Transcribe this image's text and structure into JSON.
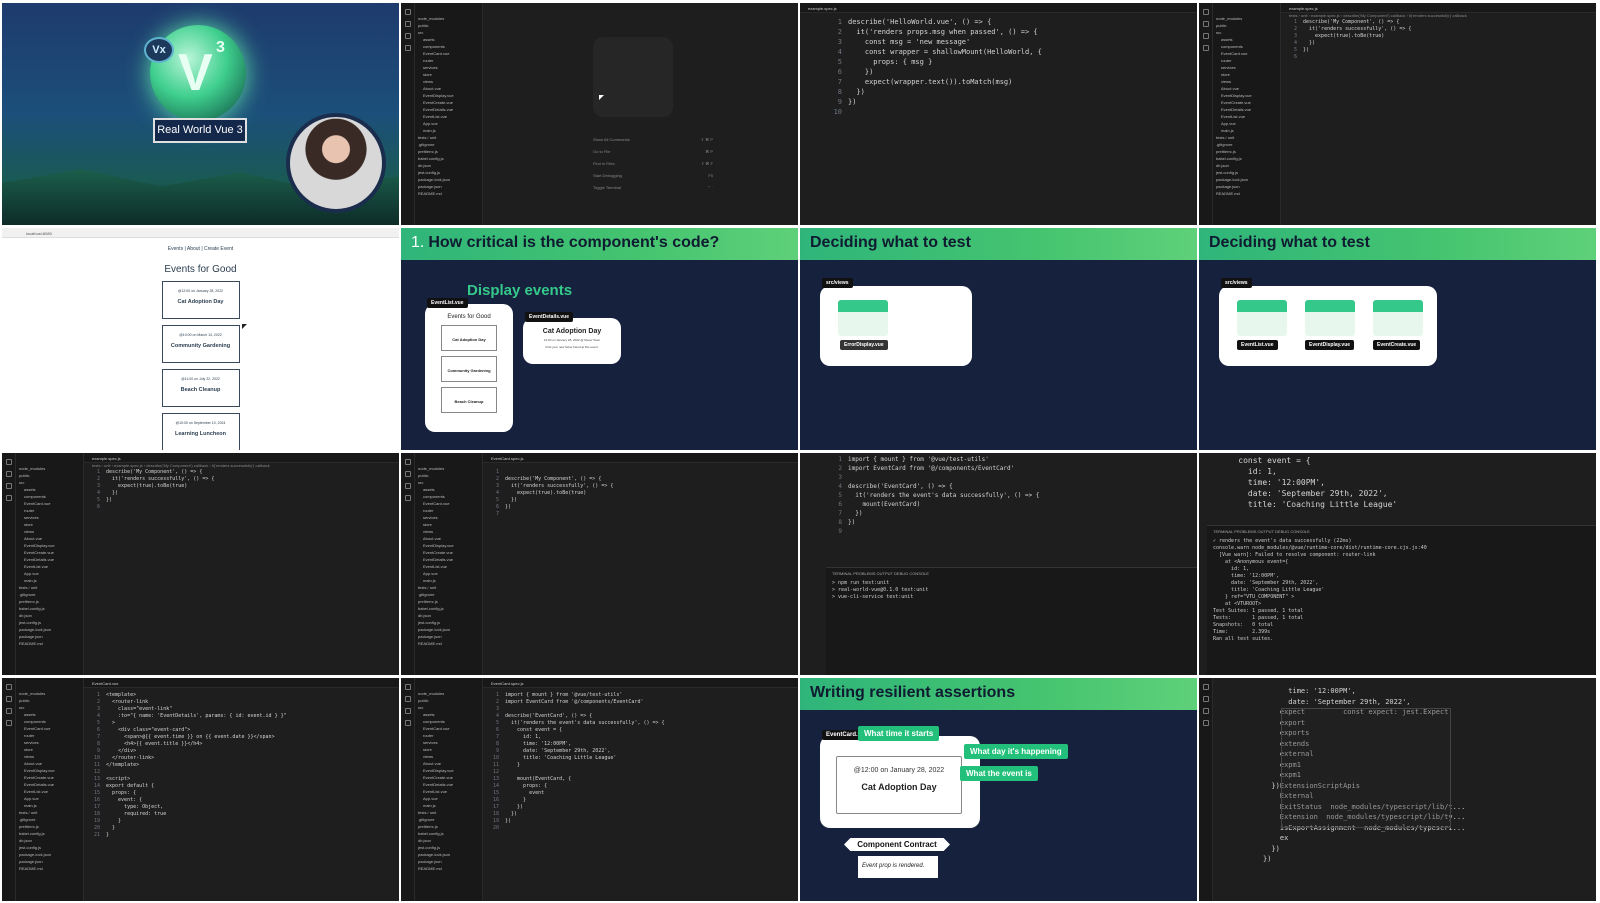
{
  "c1": {
    "logo_badge": "Vx",
    "logo_letter": "V",
    "logo_super": "3",
    "course_title": "Real World Vue 3"
  },
  "c2": {
    "tree": [
      "node_modules",
      "public",
      "src",
      "assets",
      "components",
      "EventCard.vue",
      "router",
      "services",
      "store",
      "views",
      "About.vue",
      "EventDisplay.vue",
      "EventCreate.vue",
      "EventDetails.vue",
      "EventList.vue",
      "App.vue",
      "main.js",
      "tests / unit",
      ".gitignore",
      "prettierrc.js",
      "babel.config.js",
      "db.json",
      "jest.config.js",
      "package-lock.json",
      "package.json",
      "README.md"
    ],
    "shortcuts": [
      {
        "label": "Show All Commands",
        "keys": "⇧ ⌘ P"
      },
      {
        "label": "Go to File",
        "keys": "⌘ P"
      },
      {
        "label": "Find in Files",
        "keys": "⇧ ⌘ F"
      },
      {
        "label": "Start Debugging",
        "keys": "F5"
      },
      {
        "label": "Toggle Terminal",
        "keys": "⌃ `"
      }
    ]
  },
  "c3": {
    "tab": "example.spec.js",
    "lines": [
      "describe('HelloWorld.vue', () => {",
      "  it('renders props.msg when passed', () => {",
      "    const msg = 'new message'",
      "    const wrapper = shallowMount(HelloWorld, {",
      "      props: { msg }",
      "    })",
      "    expect(wrapper.text()).toMatch(msg)",
      "  })",
      "})",
      ""
    ]
  },
  "c4": {
    "tab": "example.spec.js",
    "crumb": "tests › unit › example.spec.js › describe('My Component') callback › it('renders successfully') callback",
    "lines": [
      "describe('My Component', () => {",
      "  it('renders successfully', () => {",
      "    expect(true).toBe(true)",
      "  })",
      "})",
      ""
    ]
  },
  "c5": {
    "url": "localhost:8080",
    "nav": "Events | About | Create Event",
    "heading": "Events for Good",
    "events": [
      {
        "time": "@12:00 on January 28, 2022",
        "title": "Cat Adoption Day"
      },
      {
        "time": "@10:00 on March 14, 2022",
        "title": "Community Gardening"
      },
      {
        "time": "@11:00 on July 22, 2022",
        "title": "Beach Cleanup"
      },
      {
        "time": "@10:00 on September 10, 2024",
        "title": "Learning Luncheon"
      }
    ]
  },
  "c6": {
    "number": "1.",
    "title": "How critical is the component's code?",
    "subtitle": "Display events",
    "eventlist_label": "EventList.vue",
    "eventdetails_label": "EventDetails.vue",
    "list_heading": "Events for Good",
    "list_items": [
      "Cat Adoption Day",
      "Community Gardening",
      "Beach Cleanup"
    ],
    "detail_title": "Cat Adoption Day",
    "detail_meta": "12:00 on January 28, 2022 @ Meow Town",
    "detail_desc": "Find your new feline friend at this event."
  },
  "c7": {
    "title": "Deciding what to test",
    "folder": "src/views",
    "file": "ErrorDisplay.vue"
  },
  "c8": {
    "title": "Deciding what to test",
    "folder": "src/views",
    "files": [
      "EventList.vue",
      "EventDisplay.vue",
      "EventCreate.vue"
    ]
  },
  "c9": {
    "tab": "example.spec.js",
    "lines": [
      "describe('My Component', () => {",
      "  it('renders successfully', () => {",
      "    expect(true).toBe(true)",
      "  })",
      "})",
      ""
    ]
  },
  "c10": {
    "tab": "EventCard.spec.js",
    "lines": [
      "",
      "describe('My Component', () => {",
      "  it('renders successfully', () => {",
      "    expect(true).toBe(true)",
      "  })",
      "})",
      ""
    ]
  },
  "c11": {
    "lines": [
      "import { mount } from '@vue/test-utils'",
      "import EventCard from '@/components/EventCard'",
      "",
      "describe('EventCard', () => {",
      "  it('renders the event's data successfully', () => {",
      "    mount(EventCard)",
      "  })",
      "})",
      ""
    ],
    "term_tabs": "TERMINAL   PROBLEMS   OUTPUT   DEBUG CONSOLE",
    "term": [
      "> npm run test:unit",
      "",
      "> real-world-vue@0.1.0 test:unit",
      "> vue-cli-service test:unit"
    ]
  },
  "c12": {
    "lines": [
      "    const event = {",
      "      id: 1,",
      "      time: '12:00PM',",
      "      date: 'September 29th, 2022',",
      "      title: 'Coaching Little League'"
    ],
    "term_tabs": "TERMINAL   PROBLEMS   OUTPUT   DEBUG CONSOLE",
    "term": [
      "✓ renders the event's data successfully (22ms)",
      "",
      "console.warn node_modules/@vue/runtime-core/dist/runtime-core.cjs.js:40",
      "  [Vue warn]: Failed to resolve component: router-link",
      "    at <Anonymous event={",
      "      id: 1,",
      "      time: '12:00PM',",
      "      date: 'September 29th, 2022',",
      "      title: 'Coaching Little League'",
      "    } ref=\"VTU_COMPONENT\" >",
      "    at <VTUROOT>",
      "",
      "Test Suites: 1 passed, 1 total",
      "Tests:       1 passed, 1 total",
      "Snapshots:   0 total",
      "Time:        2.399s",
      "Ran all test suites."
    ]
  },
  "c13": {
    "tab": "EventCard.vue",
    "lines": [
      "<template>",
      "  <router-link",
      "    class=\"event-link\"",
      "    :to=\"{ name: 'EventDetails', params: { id: event.id } }\"",
      "  >",
      "    <div class=\"event-card\">",
      "      <span>@{{ event.time }} on {{ event.date }}</span>",
      "      <h4>{{ event.title }}</h4>",
      "    </div>",
      "  </router-link>",
      "</template>",
      "",
      "<script>",
      "export default {",
      "  props: {",
      "    event: {",
      "      type: Object,",
      "      required: true",
      "    }",
      "  }",
      "}"
    ]
  },
  "c14": {
    "tab": "EventCard.spec.js",
    "lines": [
      "import { mount } from '@vue/test-utils'",
      "import EventCard from '@/components/EventCard'",
      "",
      "describe('EventCard', () => {",
      "  it('renders the event's data successfully', () => {",
      "    const event = {",
      "      id: 1,",
      "      time: '12:00PM',",
      "      date: 'September 29th, 2022',",
      "      title: 'Coaching Little League'",
      "    }",
      "",
      "    mount(EventCard, {",
      "      props: {",
      "        event",
      "      }",
      "    })",
      "  })",
      "})",
      ""
    ]
  },
  "c15": {
    "title": "Writing resilient assertions",
    "file": "EventCard.vue",
    "card_time": "@12:00 on January 28, 2022",
    "card_title": "Cat Adoption Day",
    "tag1": "What time it starts",
    "tag2": "What day it's happening",
    "tag3": "What the event is",
    "contract": "Component Contract",
    "contract_note": "Event prop is rendered."
  },
  "c16": {
    "lines": [
      "      time: '12:00PM',",
      "      date: 'September 29th, 2022',",
      "    expect         const expect: jest.Expect",
      "    export",
      "    exports",
      "    extends",
      "    external",
      "    expm1",
      "    expm1",
      "  })ExtensionScriptApis",
      "    External",
      "    ExitStatus  node_modules/typescript/lib/t...",
      "    Extension  node_modules/typescript/lib/ty...",
      "    isExportAssignment  node_modules/typescri...",
      "    ex",
      "  })",
      "})"
    ]
  }
}
